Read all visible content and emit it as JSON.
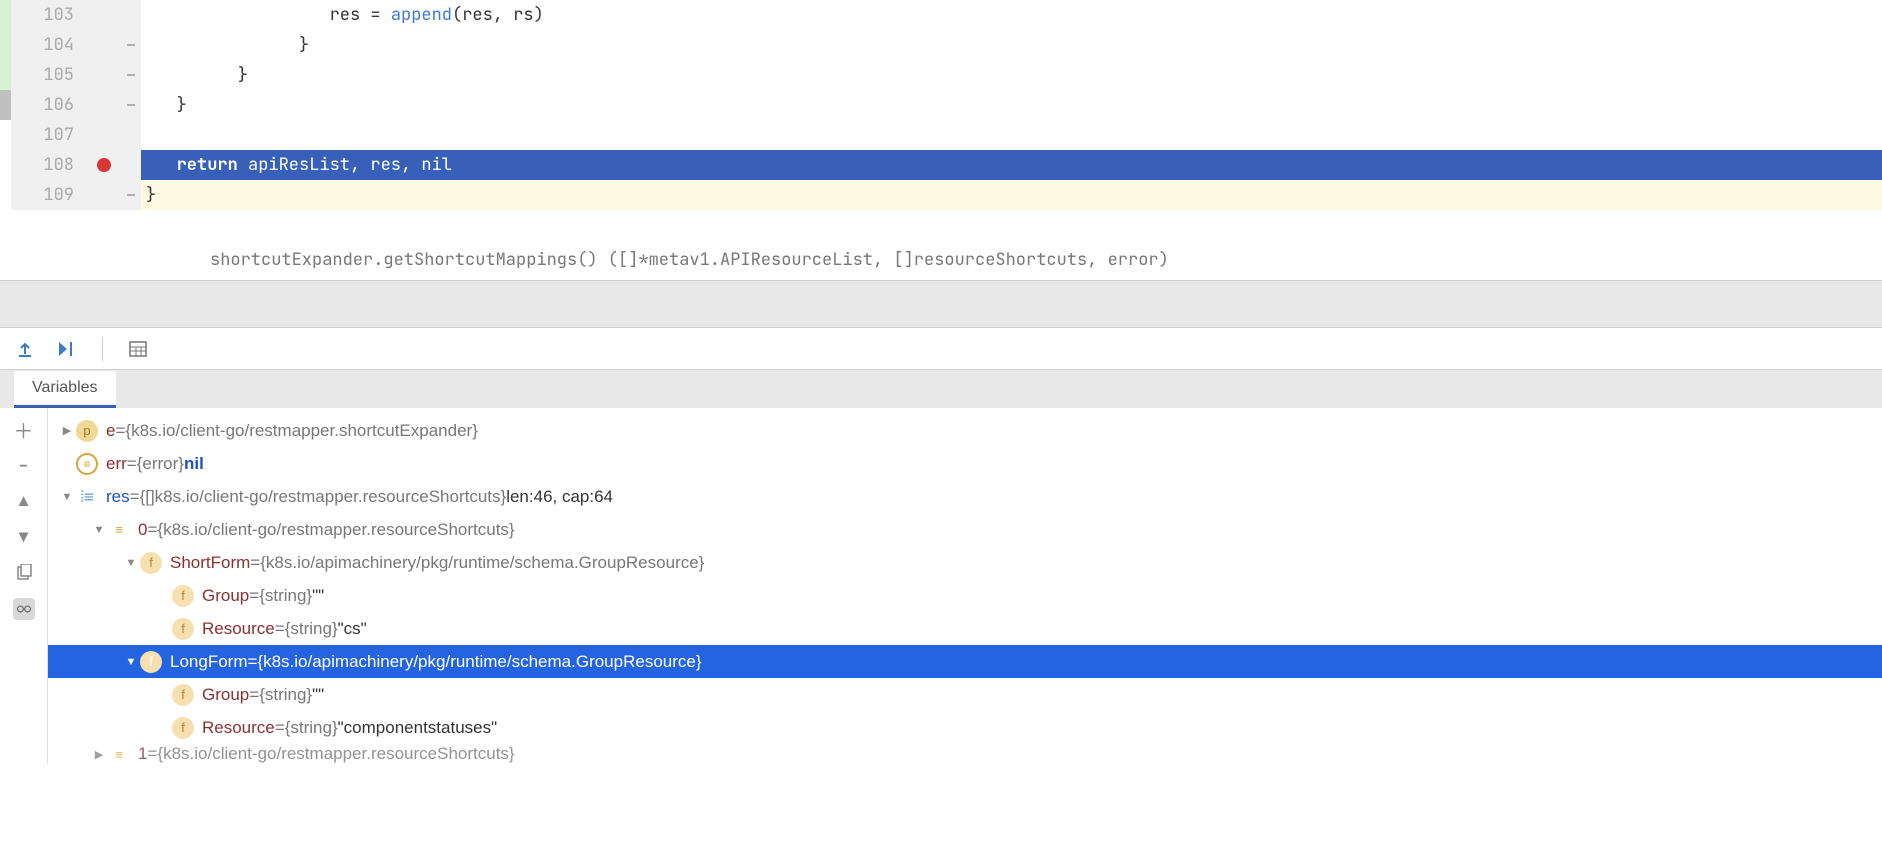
{
  "editor": {
    "lines": [
      {
        "num": "103",
        "change": "green",
        "fold": false,
        "indent": "                  ",
        "tokens": [
          {
            "t": "res = ",
            "c": ""
          },
          {
            "t": "append",
            "c": "fn"
          },
          {
            "t": "(res, rs)",
            "c": ""
          }
        ]
      },
      {
        "num": "104",
        "change": "green",
        "fold": true,
        "indent": "               ",
        "tokens": [
          {
            "t": "}",
            "c": ""
          }
        ]
      },
      {
        "num": "105",
        "change": "green",
        "fold": true,
        "indent": "         ",
        "tokens": [
          {
            "t": "}",
            "c": ""
          }
        ]
      },
      {
        "num": "106",
        "change": "gray",
        "fold": true,
        "indent": "   ",
        "tokens": [
          {
            "t": "}",
            "c": ""
          }
        ]
      },
      {
        "num": "107",
        "change": "",
        "fold": false,
        "indent": "",
        "tokens": []
      },
      {
        "num": "108",
        "change": "",
        "fold": false,
        "bp": true,
        "hl": true,
        "indent": "   ",
        "tokens": [
          {
            "t": "return",
            "c": "kw"
          },
          {
            "t": " apiResList, res, nil",
            "c": ""
          }
        ]
      },
      {
        "num": "109",
        "change": "",
        "fold": true,
        "yellow": true,
        "indent": "",
        "tokens": [
          {
            "t": "}",
            "c": ""
          }
        ]
      }
    ],
    "breadcrumb": "shortcutExpander.getShortcutMappings() ([]*metav1.APIResourceList, []resourceShortcuts, error)"
  },
  "debug": {
    "tab_label": "Variables",
    "tree": [
      {
        "depth": 0,
        "exp": "closed",
        "badge": "p",
        "name": "e",
        "eq": " = ",
        "type": "{k8s.io/client-go/restmapper.shortcutExpander}",
        "val": ""
      },
      {
        "depth": 0,
        "exp": "",
        "badge": "equals",
        "name": "err",
        "eq": " = ",
        "type": "{error} ",
        "val": "nil",
        "valClass": "var-val"
      },
      {
        "depth": 0,
        "exp": "open",
        "badge": "list",
        "name": "res",
        "nameClass": "blue",
        "eq": " = ",
        "type": "{[]k8s.io/client-go/restmapper.resourceShortcuts} ",
        "extra": "len:46, cap:64"
      },
      {
        "depth": 1,
        "exp": "open",
        "badge": "rows",
        "name": "0",
        "eq": " = ",
        "type": "{k8s.io/client-go/restmapper.resourceShortcuts}"
      },
      {
        "depth": 2,
        "exp": "open",
        "badge": "f",
        "name": "ShortForm",
        "eq": " = ",
        "type": "{k8s.io/apimachinery/pkg/runtime/schema.GroupResource}"
      },
      {
        "depth": 3,
        "exp": "",
        "badge": "f",
        "name": "Group",
        "eq": " = ",
        "type": "{string} ",
        "val": "\"\"",
        "valClass": "green"
      },
      {
        "depth": 3,
        "exp": "",
        "badge": "f",
        "name": "Resource",
        "eq": " = ",
        "type": "{string} ",
        "val": "\"cs\"",
        "valClass": "green"
      },
      {
        "depth": 2,
        "exp": "open",
        "badge": "f",
        "name": "LongForm",
        "eq": " = ",
        "type": "{k8s.io/apimachinery/pkg/runtime/schema.GroupResource}",
        "selected": true
      },
      {
        "depth": 3,
        "exp": "",
        "badge": "f",
        "name": "Group",
        "eq": " = ",
        "type": "{string} ",
        "val": "\"\"",
        "valClass": "green"
      },
      {
        "depth": 3,
        "exp": "",
        "badge": "f",
        "name": "Resource",
        "eq": " = ",
        "type": "{string} ",
        "val": "\"componentstatuses\"",
        "valClass": "green"
      },
      {
        "depth": 1,
        "exp": "closed",
        "badge": "rows",
        "name": "1",
        "eq": " = ",
        "type": "{k8s.io/client-go/restmapper.resourceShortcuts}",
        "cut": true
      }
    ]
  }
}
